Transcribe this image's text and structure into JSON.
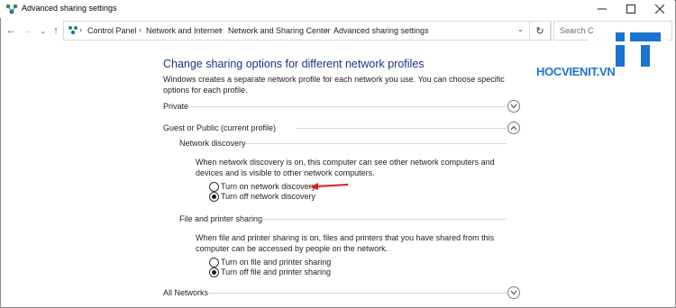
{
  "window": {
    "title": "Advanced sharing settings",
    "controls": [
      "minimize",
      "maximize",
      "close"
    ]
  },
  "address_bar": {
    "breadcrumbs": [
      "Control Panel",
      "Network and Internet",
      "Network and Sharing Center",
      "Advanced sharing settings"
    ],
    "search_placeholder": "Search C"
  },
  "content": {
    "heading": "Change sharing options for different network profiles",
    "description": "Windows creates a separate network profile for each network you use. You can choose specific options for each profile.",
    "profiles": [
      {
        "label": "Private",
        "expanded": false
      },
      {
        "label": "Guest or Public (current profile)",
        "expanded": true
      },
      {
        "label": "All Networks",
        "expanded": false
      }
    ],
    "network_discovery": {
      "title": "Network discovery",
      "description": "When network discovery is on, this computer can see other network computers and devices and is visible to other network computers.",
      "options": [
        {
          "label": "Turn on network discovery",
          "checked": false
        },
        {
          "label": "Turn off network discovery",
          "checked": true
        }
      ]
    },
    "file_printer_sharing": {
      "title": "File and printer sharing",
      "description": "When file and printer sharing is on, files and printers that you have shared from this computer can be accessed by people on the network.",
      "options": [
        {
          "label": "Turn on file and printer sharing",
          "checked": false
        },
        {
          "label": "Turn off file and printer sharing",
          "checked": true
        }
      ]
    }
  },
  "watermark": {
    "text": "HOCVIENIT.VN",
    "color": "#1d73d0"
  },
  "colors": {
    "heading": "#1e3287",
    "annotation_arrow": "#d42020"
  }
}
